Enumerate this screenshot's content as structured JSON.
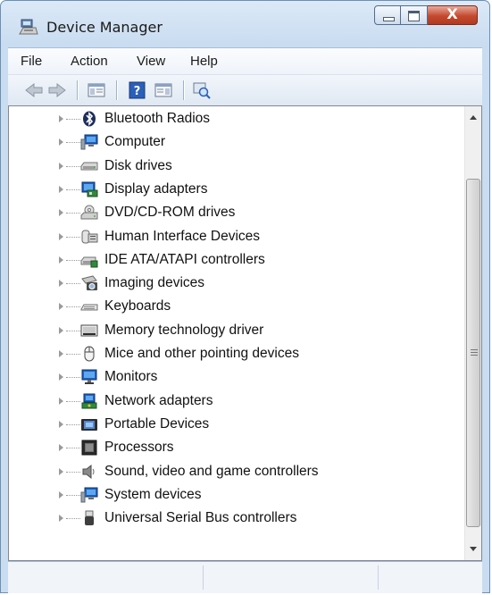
{
  "window": {
    "title": "Device Manager",
    "icon": "device-manager-icon",
    "close_glyph": "X"
  },
  "menu": [
    "File",
    "Action",
    "View",
    "Help"
  ],
  "toolbar": {
    "buttons": [
      "back-arrow-icon",
      "forward-arrow-icon",
      "show-hide-console-tree-icon",
      "help-icon",
      "show-hide-action-pane-icon",
      "scan-hardware-changes-icon"
    ]
  },
  "tree": {
    "items": [
      {
        "label": "Bluetooth Radios",
        "icon": "bluetooth-icon"
      },
      {
        "label": "Computer",
        "icon": "computer-icon"
      },
      {
        "label": "Disk drives",
        "icon": "disk-drive-icon"
      },
      {
        "label": "Display adapters",
        "icon": "display-adapter-icon"
      },
      {
        "label": "DVD/CD-ROM drives",
        "icon": "dvd-drive-icon"
      },
      {
        "label": "Human Interface Devices",
        "icon": "hid-icon"
      },
      {
        "label": "IDE ATA/ATAPI controllers",
        "icon": "ide-controller-icon"
      },
      {
        "label": "Imaging devices",
        "icon": "imaging-device-icon"
      },
      {
        "label": "Keyboards",
        "icon": "keyboard-icon"
      },
      {
        "label": "Memory technology driver",
        "icon": "memory-icon"
      },
      {
        "label": "Mice and other pointing devices",
        "icon": "mouse-icon"
      },
      {
        "label": "Monitors",
        "icon": "monitor-icon"
      },
      {
        "label": "Network adapters",
        "icon": "network-adapter-icon"
      },
      {
        "label": "Portable Devices",
        "icon": "portable-device-icon"
      },
      {
        "label": "Processors",
        "icon": "processor-icon"
      },
      {
        "label": "Sound, video and game controllers",
        "icon": "sound-icon"
      },
      {
        "label": "System devices",
        "icon": "system-device-icon"
      },
      {
        "label": "Universal Serial Bus controllers",
        "icon": "usb-icon"
      }
    ]
  },
  "colors": {
    "frame": "#c9dcf0",
    "close_button": "#c4492e",
    "tree_background": "#ffffff"
  }
}
